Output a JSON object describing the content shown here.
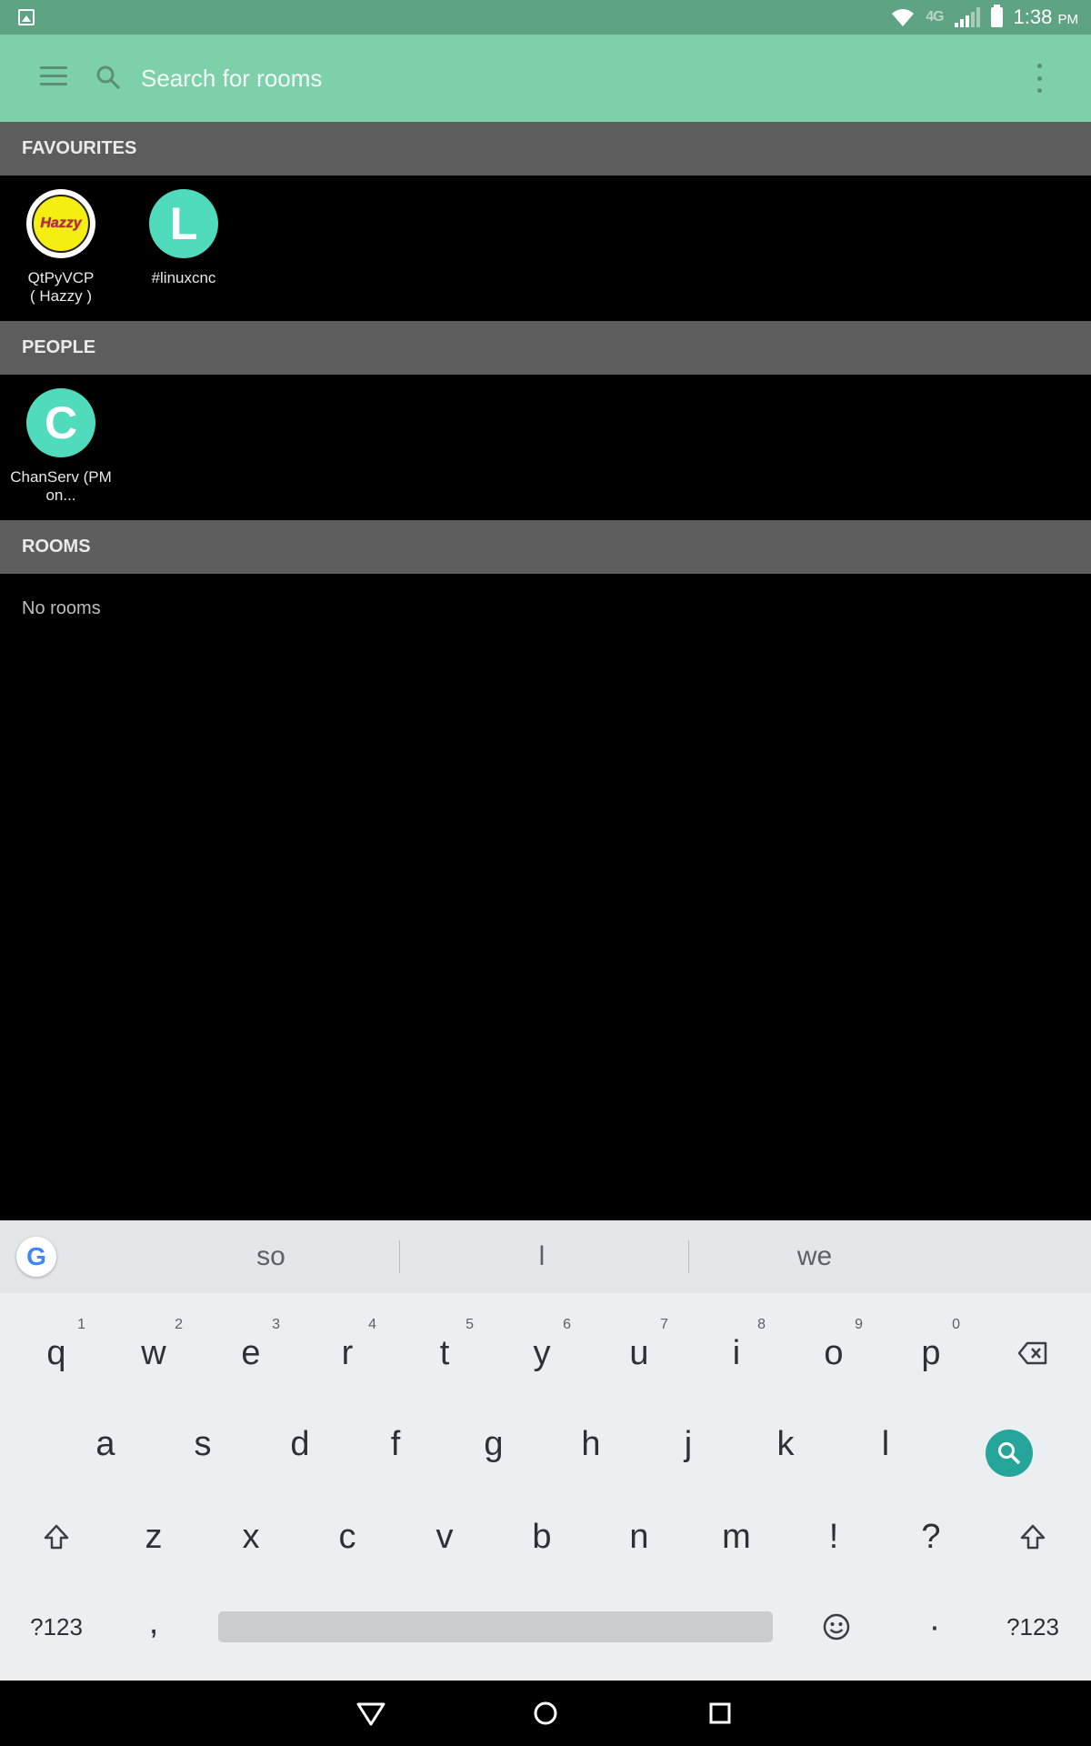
{
  "status_bar": {
    "network": "4G",
    "time": "1:38",
    "time_suffix": "PM"
  },
  "toolbar": {
    "search_placeholder": "Search for rooms"
  },
  "sections": {
    "favourites": "FAVOURITES",
    "people": "PEOPLE",
    "rooms": "ROOMS"
  },
  "favourites": [
    {
      "name_line1": "QtPyVCP",
      "name_line2": "( Hazzy )",
      "avatar_text": "Hazzy"
    },
    {
      "name_line1": "#linuxcnc",
      "name_line2": "",
      "avatar_text": "L"
    }
  ],
  "people": [
    {
      "name_line1": "ChanServ (PM",
      "name_line2": "on...",
      "avatar_text": "C"
    }
  ],
  "rooms": {
    "empty_text": "No rooms"
  },
  "keyboard": {
    "logo": "G",
    "suggestions": [
      "so",
      "l",
      "we"
    ],
    "row1": [
      {
        "k": "q",
        "n": "1"
      },
      {
        "k": "w",
        "n": "2"
      },
      {
        "k": "e",
        "n": "3"
      },
      {
        "k": "r",
        "n": "4"
      },
      {
        "k": "t",
        "n": "5"
      },
      {
        "k": "y",
        "n": "6"
      },
      {
        "k": "u",
        "n": "7"
      },
      {
        "k": "i",
        "n": "8"
      },
      {
        "k": "o",
        "n": "9"
      },
      {
        "k": "p",
        "n": "0"
      }
    ],
    "row2": [
      "a",
      "s",
      "d",
      "f",
      "g",
      "h",
      "j",
      "k",
      "l"
    ],
    "row3": [
      "z",
      "x",
      "c",
      "v",
      "b",
      "n",
      "m",
      "!",
      "?"
    ],
    "symbols_label": "?123",
    "comma": ",",
    "period": "·"
  },
  "colors": {
    "toolbar": "#7ed0aa",
    "status_bar": "#5fa385",
    "section_header": "#5d5d5d",
    "avatar": "#50dbbd",
    "search_key": "#26a69a"
  }
}
